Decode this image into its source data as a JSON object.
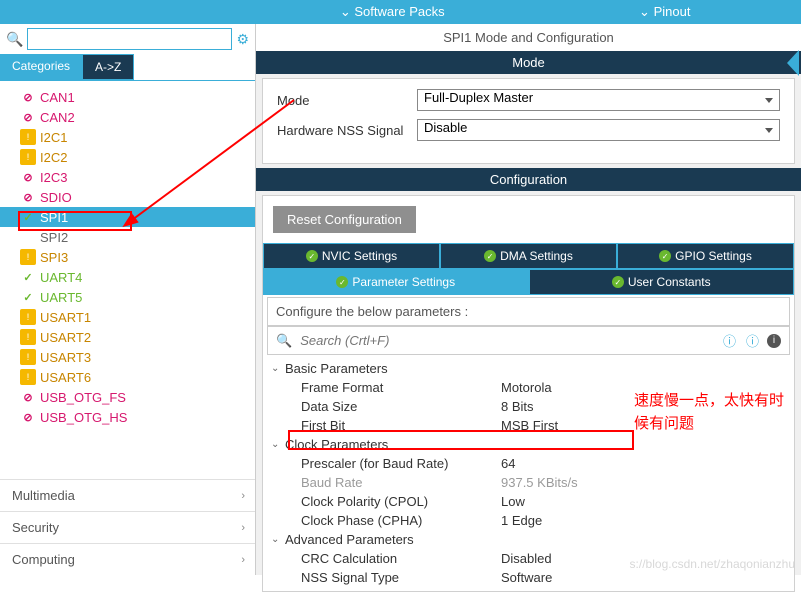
{
  "topbar": {
    "packs": "Software Packs",
    "pinout": "Pinout",
    "chev": "⌄"
  },
  "search": {
    "placeholder": ""
  },
  "tabs": {
    "categories": "Categories",
    "az": "A->Z"
  },
  "tree": [
    {
      "icon": "block",
      "cls": "lbl-pink",
      "label": "CAN1"
    },
    {
      "icon": "block",
      "cls": "lbl-pink",
      "label": "CAN2"
    },
    {
      "icon": "warn",
      "cls": "lbl-orange",
      "label": "I2C1"
    },
    {
      "icon": "warn",
      "cls": "lbl-orange",
      "label": "I2C2"
    },
    {
      "icon": "block",
      "cls": "lbl-pink",
      "label": "I2C3"
    },
    {
      "icon": "block",
      "cls": "lbl-pink",
      "label": "SDIO"
    },
    {
      "icon": "check",
      "cls": "lbl-green",
      "label": "SPI1",
      "selected": true
    },
    {
      "icon": "",
      "cls": "lbl-gray",
      "label": "SPI2"
    },
    {
      "icon": "warn",
      "cls": "lbl-orange",
      "label": "SPI3"
    },
    {
      "icon": "check",
      "cls": "lbl-green",
      "label": "UART4"
    },
    {
      "icon": "check",
      "cls": "lbl-green",
      "label": "UART5"
    },
    {
      "icon": "warn",
      "cls": "lbl-orange",
      "label": "USART1"
    },
    {
      "icon": "warn",
      "cls": "lbl-orange",
      "label": "USART2"
    },
    {
      "icon": "warn",
      "cls": "lbl-orange",
      "label": "USART3"
    },
    {
      "icon": "warn",
      "cls": "lbl-orange",
      "label": "USART6"
    },
    {
      "icon": "block",
      "cls": "lbl-pink",
      "label": "USB_OTG_FS"
    },
    {
      "icon": "block",
      "cls": "lbl-pink",
      "label": "USB_OTG_HS"
    }
  ],
  "categories": [
    "Multimedia",
    "Security",
    "Computing"
  ],
  "right": {
    "title": "SPI1 Mode and Configuration",
    "mode_hdr": "Mode",
    "mode_label": "Mode",
    "mode_value": "Full-Duplex Master",
    "nss_label": "Hardware NSS Signal",
    "nss_value": "Disable",
    "config_hdr": "Configuration",
    "reset": "Reset Configuration",
    "ctabs": [
      "NVIC Settings",
      "DMA Settings",
      "GPIO Settings",
      "Parameter Settings",
      "User Constants"
    ],
    "hint": "Configure the below parameters :",
    "search_ph": "Search (Crtl+F)",
    "groups": [
      {
        "name": "Basic Parameters",
        "rows": [
          {
            "n": "Frame Format",
            "v": "Motorola"
          },
          {
            "n": "Data Size",
            "v": "8 Bits"
          },
          {
            "n": "First Bit",
            "v": "MSB First"
          }
        ]
      },
      {
        "name": "Clock Parameters",
        "rows": [
          {
            "n": "Prescaler (for Baud Rate)",
            "v": "64"
          },
          {
            "n": "Baud Rate",
            "v": "937.5 KBits/s",
            "dim": true
          },
          {
            "n": "Clock Polarity (CPOL)",
            "v": "Low"
          },
          {
            "n": "Clock Phase (CPHA)",
            "v": "1 Edge"
          }
        ]
      },
      {
        "name": "Advanced Parameters",
        "rows": [
          {
            "n": "CRC Calculation",
            "v": "Disabled"
          },
          {
            "n": "NSS Signal Type",
            "v": "Software"
          }
        ]
      }
    ]
  },
  "annotation": "速度慢一点，太快有时候有问题",
  "watermark": "s://blog.csdn.net/zhaqonianzhu"
}
